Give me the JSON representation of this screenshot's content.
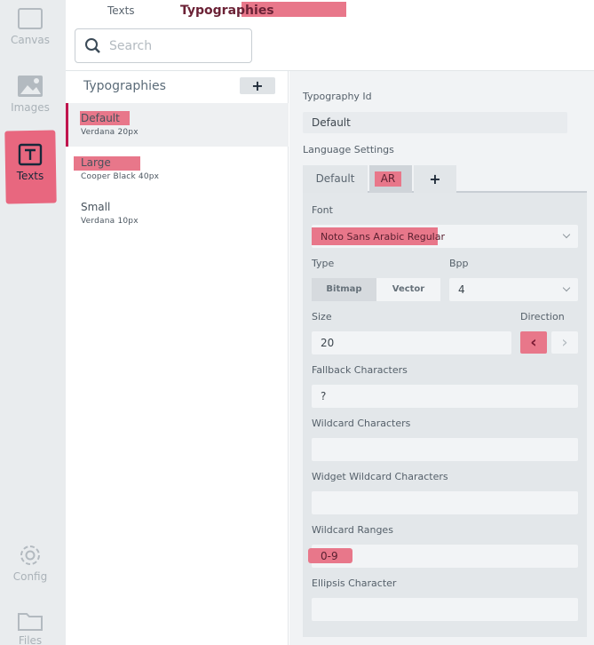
{
  "rail": {
    "items": [
      {
        "label": "Canvas",
        "icon": "canvas-icon"
      },
      {
        "label": "Images",
        "icon": "image-icon"
      },
      {
        "label": "Texts",
        "icon": "text-icon"
      },
      {
        "label": "Config",
        "icon": "gear-icon"
      },
      {
        "label": "Files",
        "icon": "folder-icon"
      }
    ]
  },
  "top": {
    "tabs": [
      {
        "label": "Texts"
      },
      {
        "label": "Typographies"
      }
    ],
    "search_placeholder": "Search"
  },
  "list": {
    "title": "Typographies",
    "add_label": "+",
    "items": [
      {
        "name": "Default",
        "sub": "Verdana  20px"
      },
      {
        "name": "Large",
        "sub": "Cooper Black  40px"
      },
      {
        "name": "Small",
        "sub": "Verdana  10px"
      }
    ]
  },
  "props": {
    "typography_id_label": "Typography Id",
    "typography_id_value": "Default",
    "language_settings_label": "Language Settings",
    "lang_tabs": [
      {
        "label": "Default"
      },
      {
        "label": "AR"
      },
      {
        "label": "+"
      }
    ],
    "font_label": "Font",
    "font_value": "Noto Sans Arabic Regular",
    "type_label": "Type",
    "type_options": [
      "Bitmap",
      "Vector"
    ],
    "bpp_label": "Bpp",
    "bpp_value": "4",
    "size_label": "Size",
    "size_value": "20",
    "direction_label": "Direction",
    "direction_left": "‹",
    "direction_right": "›",
    "fallback_label": "Fallback Characters",
    "fallback_value": "?",
    "wildcard_label": "Wildcard Characters",
    "wildcard_value": "",
    "widget_wildcard_label": "Widget Wildcard Characters",
    "widget_wildcard_value": "",
    "wildcard_ranges_label": "Wildcard Ranges",
    "wildcard_ranges_value": "0-9",
    "ellipsis_label": "Ellipsis Character",
    "ellipsis_value": ""
  },
  "colors": {
    "highlight": "#e8778a",
    "accent": "#c0154e",
    "active_text": "#6b2236"
  }
}
